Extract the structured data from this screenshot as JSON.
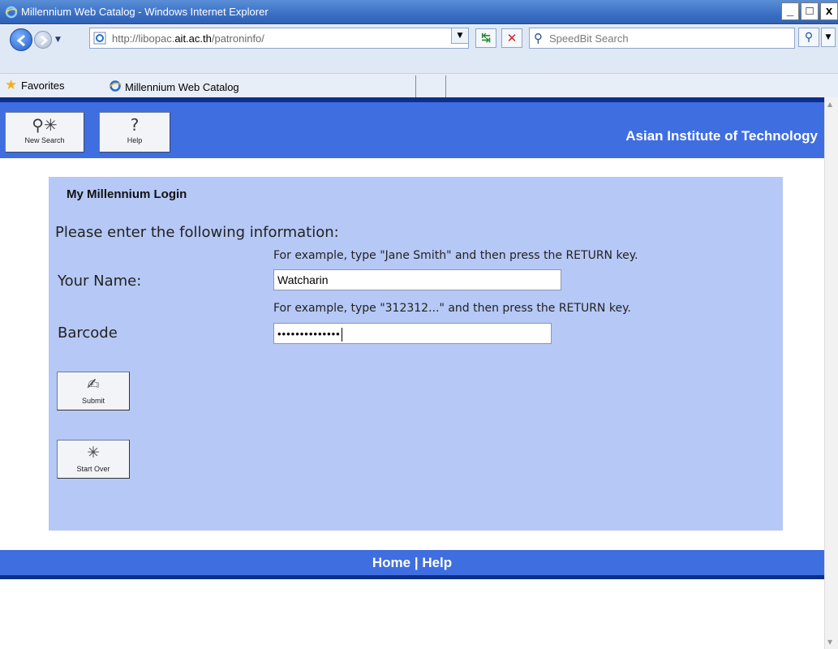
{
  "window": {
    "title": "Millennium Web Catalog - Windows Internet Explorer",
    "buttons": [
      "_",
      "□",
      "x"
    ]
  },
  "addressbar": {
    "url_prefix": "http://libopac.",
    "url_domain": "ait.ac.th",
    "url_suffix": "/patroninfo/",
    "search_placeholder": "SpeedBit Search"
  },
  "favorites": {
    "label": "Favorites",
    "tab_label": "Millennium Web Catalog"
  },
  "header": {
    "new_search_label": "New Search",
    "help_label": "Help",
    "org_name": "Asian Institute of Technology"
  },
  "login": {
    "title": "My Millennium Login",
    "intro": "Please enter the following information:",
    "name_hint": "For example, type \"Jane Smith\" and then press the RETURN key.",
    "name_label": "Your Name:",
    "name_value": "Watcharin",
    "barcode_hint": "For example, type \"312312...\" and then press the RETURN key.",
    "barcode_label": "Barcode",
    "barcode_masked": "••••••••••••••",
    "submit_label": "Submit",
    "start_over_label": "Start Over"
  },
  "footer": {
    "home": "Home",
    "separator": "|",
    "help": "Help"
  },
  "colors": {
    "band": "#3f6ee0",
    "band_dark": "#0d2f8a",
    "panel": "#b6c8f5"
  }
}
